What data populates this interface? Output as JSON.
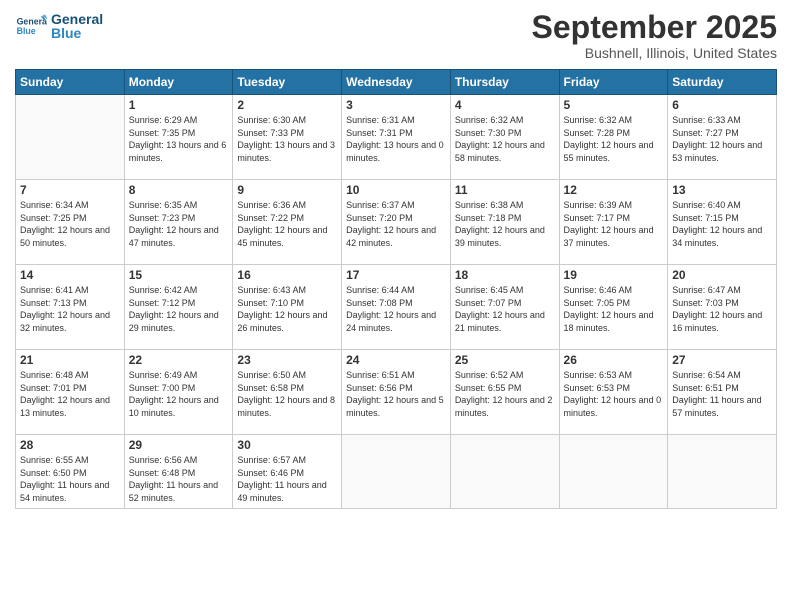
{
  "logo": {
    "text_general": "General",
    "text_blue": "Blue"
  },
  "header": {
    "title": "September 2025",
    "subtitle": "Bushnell, Illinois, United States"
  },
  "weekdays": [
    "Sunday",
    "Monday",
    "Tuesday",
    "Wednesday",
    "Thursday",
    "Friday",
    "Saturday"
  ],
  "weeks": [
    [
      {
        "day": "",
        "empty": true
      },
      {
        "day": "1",
        "sunrise": "6:29 AM",
        "sunset": "7:35 PM",
        "daylight": "13 hours and 6 minutes."
      },
      {
        "day": "2",
        "sunrise": "6:30 AM",
        "sunset": "7:33 PM",
        "daylight": "13 hours and 3 minutes."
      },
      {
        "day": "3",
        "sunrise": "6:31 AM",
        "sunset": "7:31 PM",
        "daylight": "13 hours and 0 minutes."
      },
      {
        "day": "4",
        "sunrise": "6:32 AM",
        "sunset": "7:30 PM",
        "daylight": "12 hours and 58 minutes."
      },
      {
        "day": "5",
        "sunrise": "6:32 AM",
        "sunset": "7:28 PM",
        "daylight": "12 hours and 55 minutes."
      },
      {
        "day": "6",
        "sunrise": "6:33 AM",
        "sunset": "7:27 PM",
        "daylight": "12 hours and 53 minutes."
      }
    ],
    [
      {
        "day": "7",
        "sunrise": "6:34 AM",
        "sunset": "7:25 PM",
        "daylight": "12 hours and 50 minutes."
      },
      {
        "day": "8",
        "sunrise": "6:35 AM",
        "sunset": "7:23 PM",
        "daylight": "12 hours and 47 minutes."
      },
      {
        "day": "9",
        "sunrise": "6:36 AM",
        "sunset": "7:22 PM",
        "daylight": "12 hours and 45 minutes."
      },
      {
        "day": "10",
        "sunrise": "6:37 AM",
        "sunset": "7:20 PM",
        "daylight": "12 hours and 42 minutes."
      },
      {
        "day": "11",
        "sunrise": "6:38 AM",
        "sunset": "7:18 PM",
        "daylight": "12 hours and 39 minutes."
      },
      {
        "day": "12",
        "sunrise": "6:39 AM",
        "sunset": "7:17 PM",
        "daylight": "12 hours and 37 minutes."
      },
      {
        "day": "13",
        "sunrise": "6:40 AM",
        "sunset": "7:15 PM",
        "daylight": "12 hours and 34 minutes."
      }
    ],
    [
      {
        "day": "14",
        "sunrise": "6:41 AM",
        "sunset": "7:13 PM",
        "daylight": "12 hours and 32 minutes."
      },
      {
        "day": "15",
        "sunrise": "6:42 AM",
        "sunset": "7:12 PM",
        "daylight": "12 hours and 29 minutes."
      },
      {
        "day": "16",
        "sunrise": "6:43 AM",
        "sunset": "7:10 PM",
        "daylight": "12 hours and 26 minutes."
      },
      {
        "day": "17",
        "sunrise": "6:44 AM",
        "sunset": "7:08 PM",
        "daylight": "12 hours and 24 minutes."
      },
      {
        "day": "18",
        "sunrise": "6:45 AM",
        "sunset": "7:07 PM",
        "daylight": "12 hours and 21 minutes."
      },
      {
        "day": "19",
        "sunrise": "6:46 AM",
        "sunset": "7:05 PM",
        "daylight": "12 hours and 18 minutes."
      },
      {
        "day": "20",
        "sunrise": "6:47 AM",
        "sunset": "7:03 PM",
        "daylight": "12 hours and 16 minutes."
      }
    ],
    [
      {
        "day": "21",
        "sunrise": "6:48 AM",
        "sunset": "7:01 PM",
        "daylight": "12 hours and 13 minutes."
      },
      {
        "day": "22",
        "sunrise": "6:49 AM",
        "sunset": "7:00 PM",
        "daylight": "12 hours and 10 minutes."
      },
      {
        "day": "23",
        "sunrise": "6:50 AM",
        "sunset": "6:58 PM",
        "daylight": "12 hours and 8 minutes."
      },
      {
        "day": "24",
        "sunrise": "6:51 AM",
        "sunset": "6:56 PM",
        "daylight": "12 hours and 5 minutes."
      },
      {
        "day": "25",
        "sunrise": "6:52 AM",
        "sunset": "6:55 PM",
        "daylight": "12 hours and 2 minutes."
      },
      {
        "day": "26",
        "sunrise": "6:53 AM",
        "sunset": "6:53 PM",
        "daylight": "12 hours and 0 minutes."
      },
      {
        "day": "27",
        "sunrise": "6:54 AM",
        "sunset": "6:51 PM",
        "daylight": "11 hours and 57 minutes."
      }
    ],
    [
      {
        "day": "28",
        "sunrise": "6:55 AM",
        "sunset": "6:50 PM",
        "daylight": "11 hours and 54 minutes."
      },
      {
        "day": "29",
        "sunrise": "6:56 AM",
        "sunset": "6:48 PM",
        "daylight": "11 hours and 52 minutes."
      },
      {
        "day": "30",
        "sunrise": "6:57 AM",
        "sunset": "6:46 PM",
        "daylight": "11 hours and 49 minutes."
      },
      {
        "day": "",
        "empty": true
      },
      {
        "day": "",
        "empty": true
      },
      {
        "day": "",
        "empty": true
      },
      {
        "day": "",
        "empty": true
      }
    ]
  ]
}
